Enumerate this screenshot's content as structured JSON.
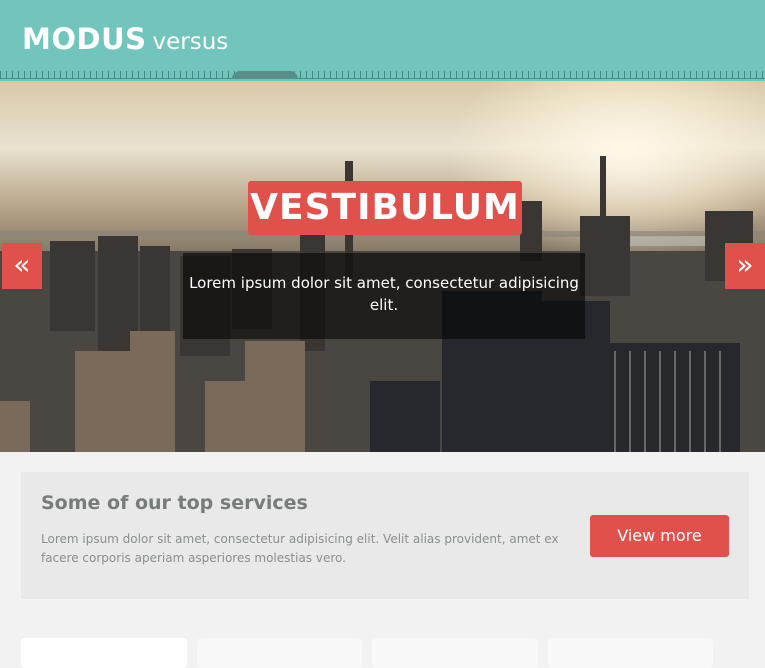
{
  "header": {
    "brand_main": "MODUS",
    "brand_sub": "versus"
  },
  "slider": {
    "title": "VESTIBULUM",
    "caption": "Lorem ipsum dolor sit amet, consectetur adipisicing elit.",
    "prev_symbol": "«",
    "next_symbol": "»"
  },
  "services": {
    "title": "Some of our top services",
    "text": "Lorem ipsum dolor sit amet, consectetur adipisicing elit. Velit alias provident, amet ex facere corporis aperiam asperiores molestias vero.",
    "button_label": "View more"
  },
  "colors": {
    "header": "#72c5bc",
    "accent": "#e0514b",
    "page_bg": "#f2f2f2"
  }
}
